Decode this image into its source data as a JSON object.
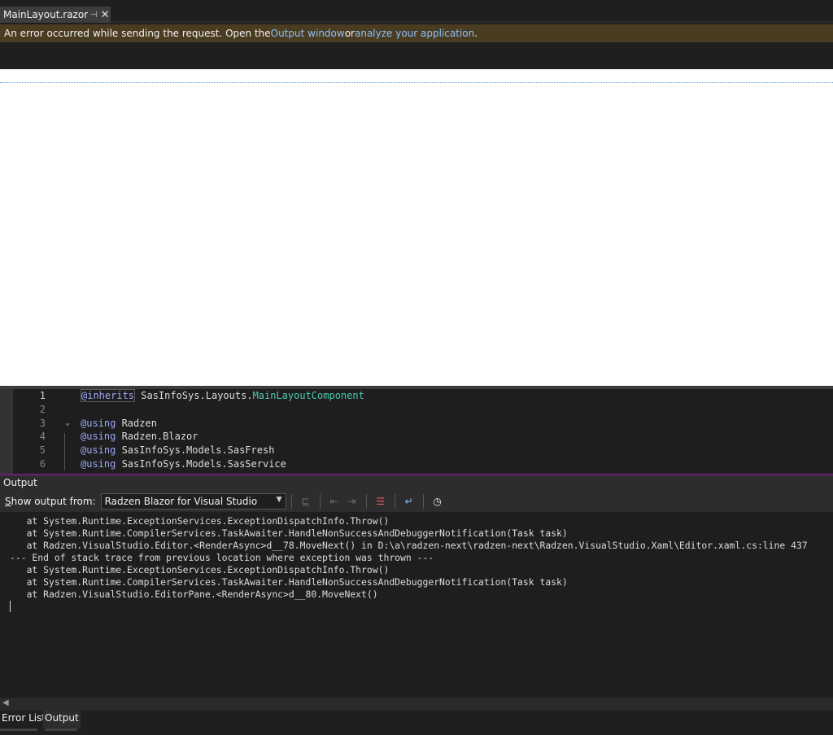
{
  "tabs": [
    {
      "name": "MainLayout.razor",
      "pin_icon": "pin-icon",
      "close_icon": "close-icon"
    }
  ],
  "infobar": {
    "text_before": "An error occurred while sending the request. Open the ",
    "link1": "Output window",
    "text_middle": " or ",
    "link2": "analyze your application",
    "text_after": "."
  },
  "editor": {
    "lines": [
      {
        "number": "1",
        "tokens": [
          {
            "t": "@inherits",
            "c": "kwbox"
          },
          {
            "t": " SasInfoSys",
            "c": ""
          },
          {
            "t": ".",
            "c": ""
          },
          {
            "t": "Layouts",
            "c": ""
          },
          {
            "t": ".",
            "c": ""
          },
          {
            "t": "MainLayoutComponent",
            "c": "type"
          }
        ]
      },
      {
        "number": "2",
        "tokens": []
      },
      {
        "number": "3",
        "tokens": [
          {
            "t": "@using",
            "c": "kw"
          },
          {
            "t": " Radzen",
            "c": ""
          }
        ]
      },
      {
        "number": "4",
        "tokens": [
          {
            "t": "@using",
            "c": "kw"
          },
          {
            "t": " Radzen.Blazor",
            "c": ""
          }
        ]
      },
      {
        "number": "5",
        "tokens": [
          {
            "t": "@using",
            "c": "kw"
          },
          {
            "t": " SasInfoSys.Models.SasFresh",
            "c": ""
          }
        ]
      },
      {
        "number": "6",
        "tokens": [
          {
            "t": "@using",
            "c": "kw"
          },
          {
            "t": " SasInfoSys.Models.SasService",
            "c": ""
          }
        ]
      }
    ]
  },
  "output": {
    "title": "Output",
    "show_from_label_underlined": "S",
    "show_from_label_rest": "how output from:",
    "source": "Radzen Blazor for Visual Studio",
    "lines": [
      "   at System.Runtime.ExceptionServices.ExceptionDispatchInfo.Throw()",
      "   at System.Runtime.CompilerServices.TaskAwaiter.HandleNonSuccessAndDebuggerNotification(Task task)",
      "   at Radzen.VisualStudio.Editor.<RenderAsync>d__78.MoveNext() in D:\\a\\radzen-next\\radzen-next\\Radzen.VisualStudio.Xaml\\Editor.xaml.cs:line 437",
      "--- End of stack trace from previous location where exception was thrown ---",
      "   at System.Runtime.ExceptionServices.ExceptionDispatchInfo.Throw()",
      "   at System.Runtime.CompilerServices.TaskAwaiter.HandleNonSuccessAndDebuggerNotification(Task task)",
      "   at Radzen.VisualStudio.EditorPane.<RenderAsync>d__80.MoveNext()"
    ]
  },
  "bottom_tabs": [
    "Error List",
    "Output"
  ],
  "colors": {
    "infobar": "#4a3c21",
    "link": "#8cc0ff",
    "keyword": "#9ea8f5",
    "type": "#4ec9b0",
    "accent": "#68217a"
  }
}
